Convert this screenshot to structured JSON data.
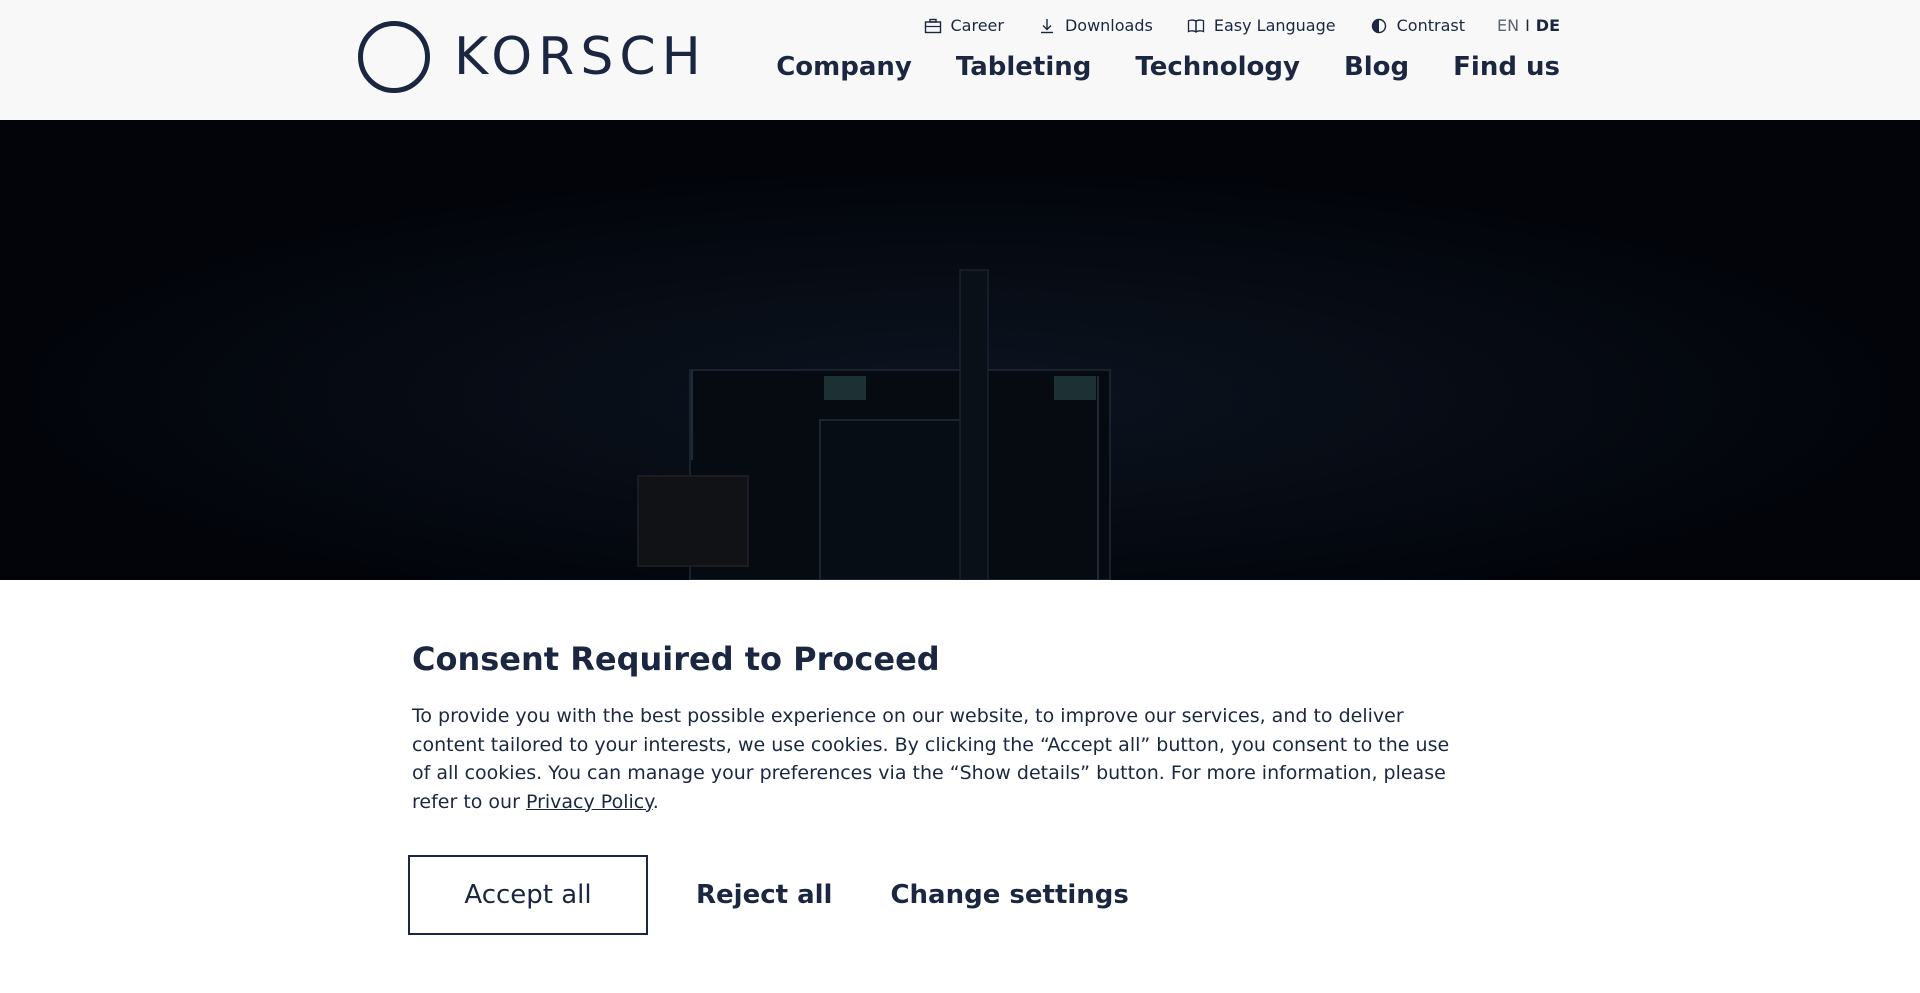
{
  "brand": {
    "name": "KORSCH"
  },
  "utility_nav": {
    "career": "Career",
    "downloads": "Downloads",
    "easy_language": "Easy Language",
    "contrast": "Contrast",
    "lang_en": "EN",
    "lang_sep": "I",
    "lang_de": "DE"
  },
  "main_nav": {
    "company": "Company",
    "tableting": "Tableting",
    "technology": "Technology",
    "blog": "Blog",
    "find_us": "Find us"
  },
  "consent": {
    "title": "Consent Required to Proceed",
    "body": "To provide you with the best possible experience on our website, to improve our services, and to deliver content tailored to your interests, we use cookies. By clicking the “Accept all” button, you consent to the use of all cookies. You can manage your preferences via the “Show details” button. For more information, please refer to our ",
    "privacy_link": "Privacy Policy",
    "body_end": ".",
    "accept_all": "Accept all",
    "reject_all": "Reject all",
    "change_settings": "Change settings"
  },
  "colors": {
    "primary": "#1b2640",
    "header_bg": "#f8f8f8",
    "hero_bg": "#03060a"
  }
}
